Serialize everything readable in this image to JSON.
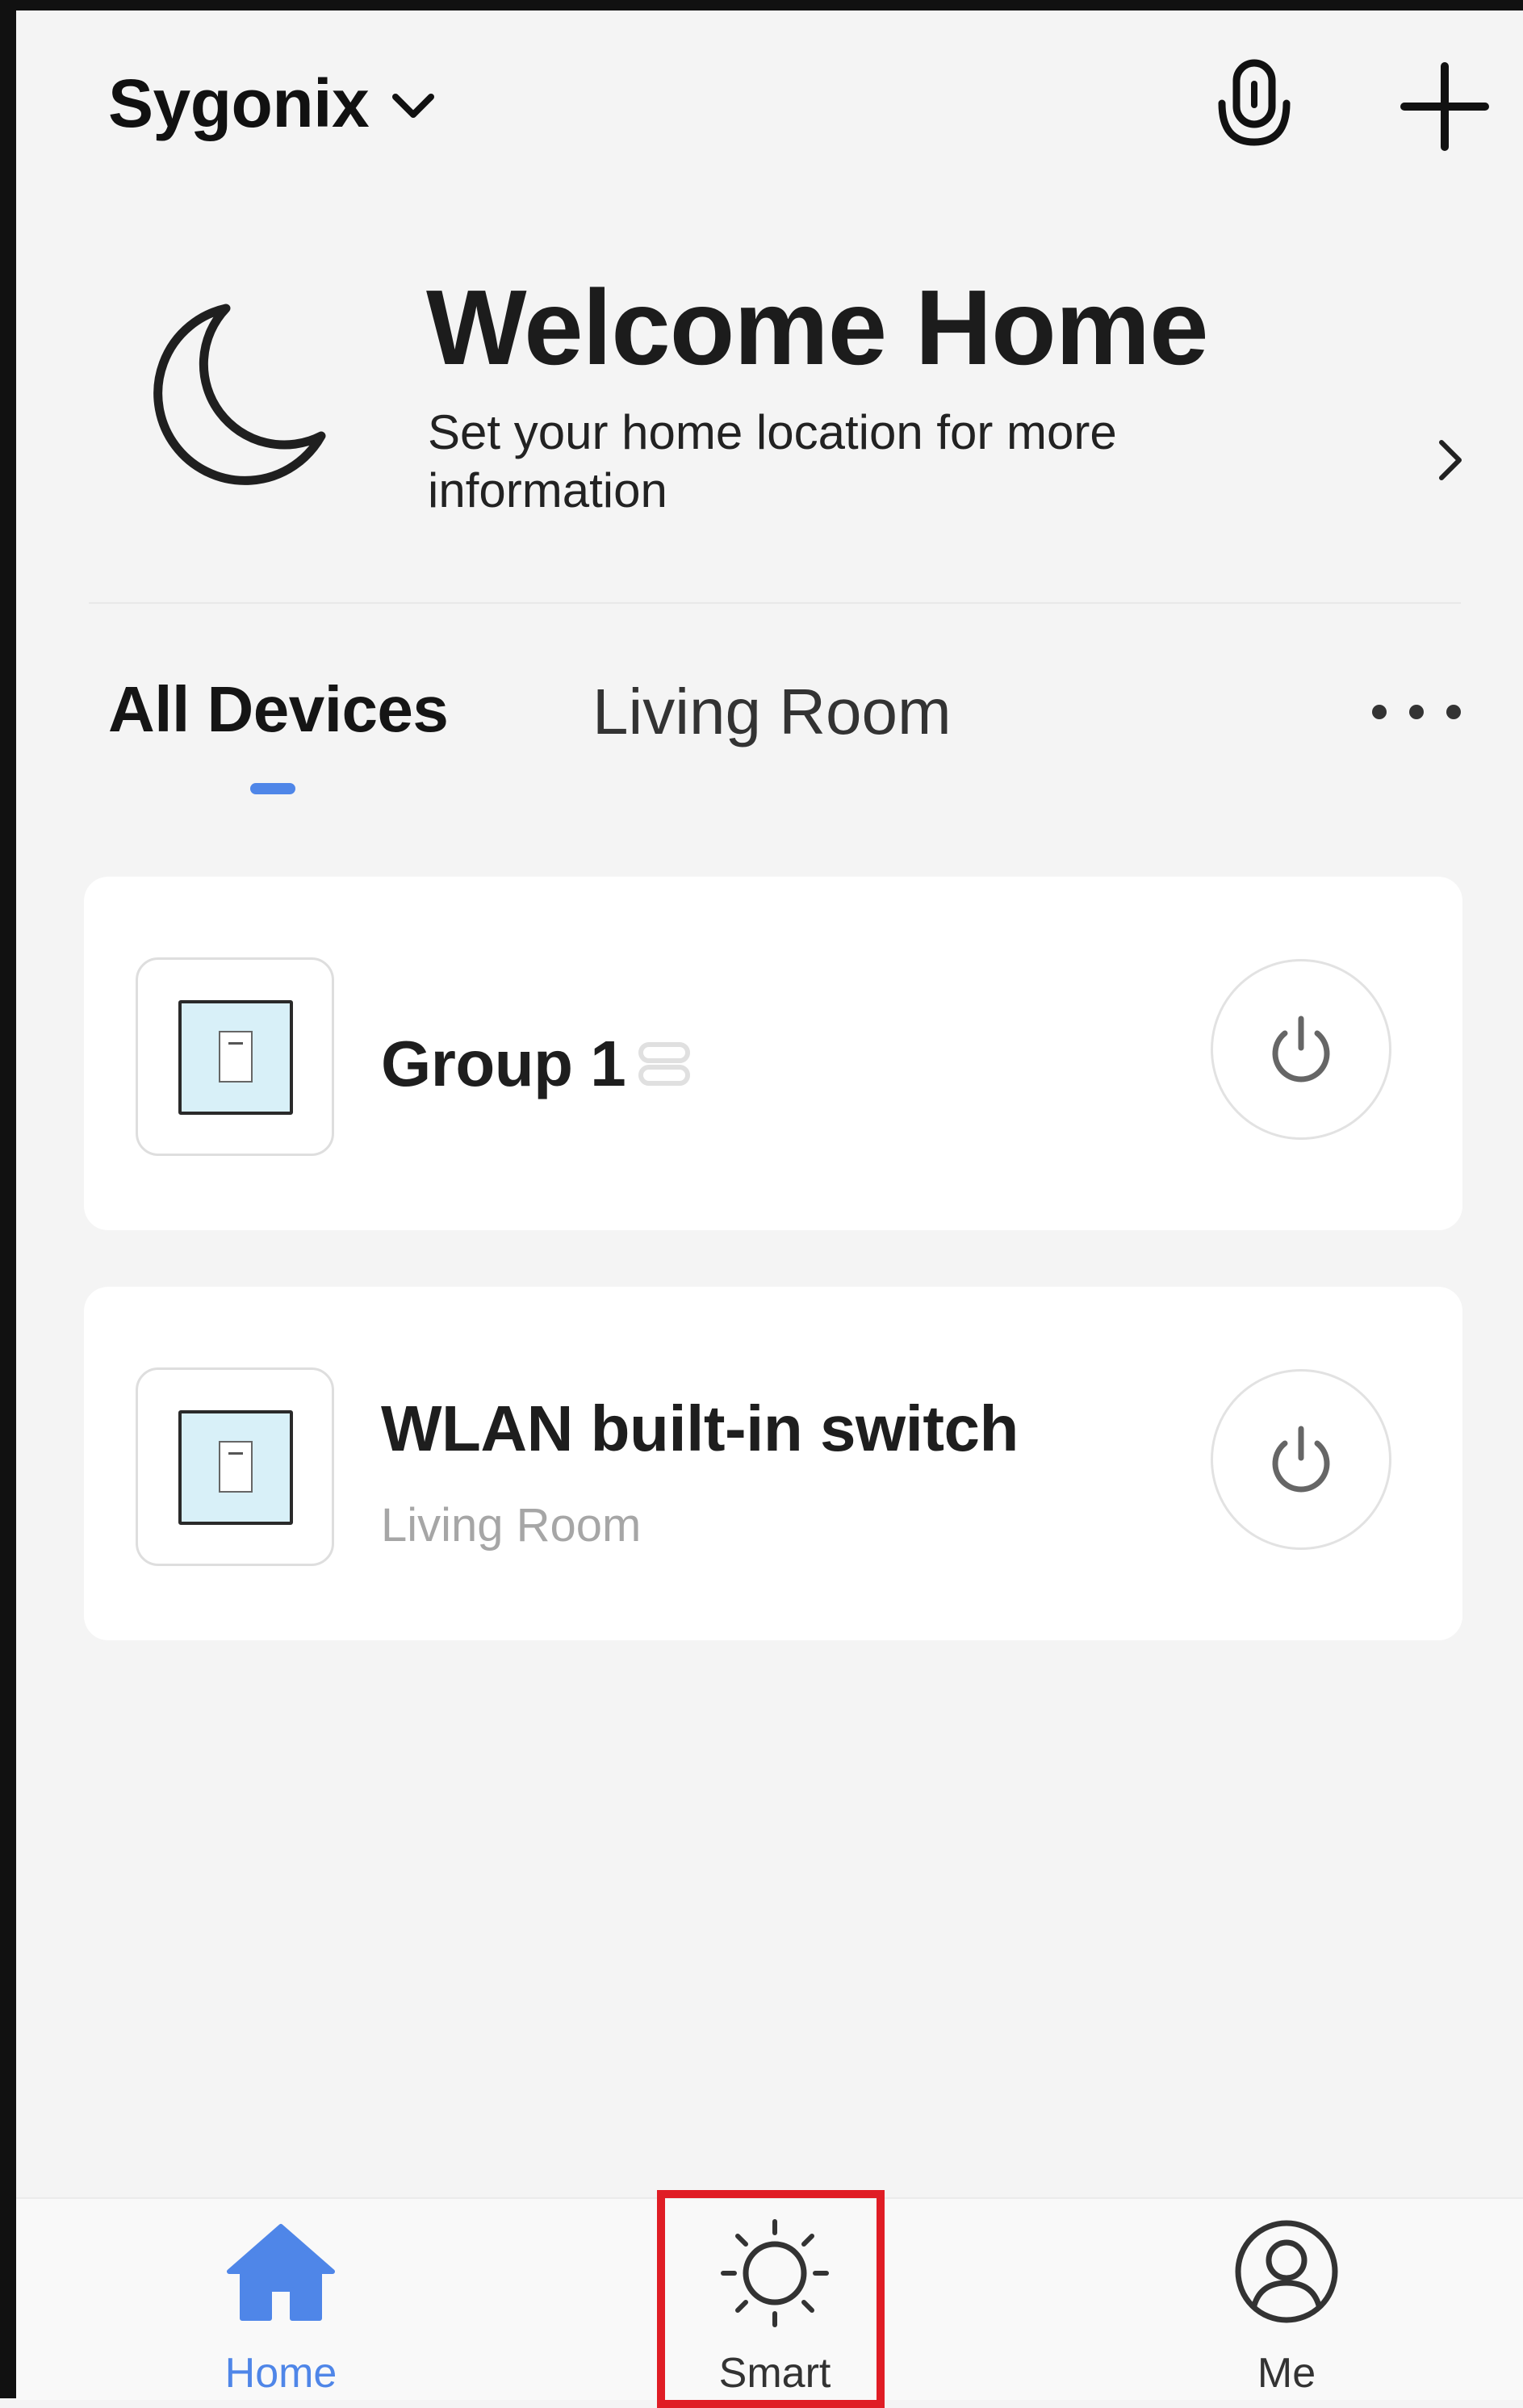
{
  "header": {
    "home_name": "Sygonix",
    "chevron_icon": "chevron-down-icon",
    "mic_icon": "microphone-icon",
    "add_icon": "plus-icon"
  },
  "welcome": {
    "icon": "moon-icon",
    "title": "Welcome Home",
    "subtitle": "Set your home location for more information",
    "arrow_icon": "chevron-right-icon"
  },
  "tabs": [
    {
      "label": "All Devices",
      "active": true
    },
    {
      "label": "Living Room",
      "active": false
    }
  ],
  "more_icon": "more-horizontal-icon",
  "devices": [
    {
      "name": "Group 1",
      "room": "",
      "is_group": true,
      "icon": "wall-switch-icon",
      "power_icon": "power-icon"
    },
    {
      "name": "WLAN built-in switch",
      "room": "Living Room",
      "is_group": false,
      "icon": "wall-switch-icon",
      "power_icon": "power-icon"
    }
  ],
  "bottom_nav": [
    {
      "label": "Home",
      "icon": "home-icon",
      "active": true
    },
    {
      "label": "Smart",
      "icon": "sun-icon",
      "active": false,
      "highlighted": true
    },
    {
      "label": "Me",
      "icon": "user-circle-icon",
      "active": false
    }
  ],
  "colors": {
    "accent": "#4f86e8",
    "background": "#f4f4f4",
    "card": "#ffffff",
    "highlight_box": "#e01d25",
    "secondary_text": "#a6a6a6"
  }
}
